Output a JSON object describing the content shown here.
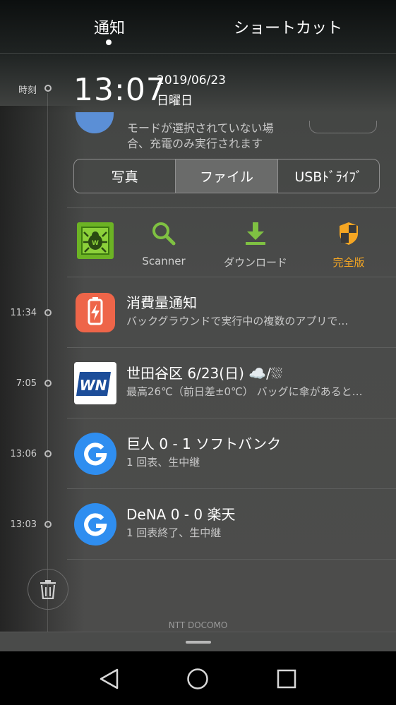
{
  "tabs": {
    "notify": "通知",
    "shortcut": "ショートカット"
  },
  "header": {
    "time_label": "時刻",
    "time": "13:07",
    "date": "2019/06/23",
    "weekday": "日曜日"
  },
  "usb": {
    "text_line1": "モードが選択されていない場",
    "text_line2": "合、充電のみ実行されます",
    "segments": [
      "写真",
      "ファイル",
      "USBﾄﾞﾗｲﾌﾞ"
    ]
  },
  "drweb": {
    "scanner": "Scanner",
    "download": "ダウンロード",
    "full": "完全版",
    "accent": "#f5a623"
  },
  "notifications": [
    {
      "time": "11:34",
      "title": "消費量通知",
      "body": "バックグラウンドで実行中の複数のアプリで…",
      "icon": "battery-alert-icon",
      "color": "#ee6549"
    },
    {
      "time": "7:05",
      "title": "世田谷区 6/23(日) ☁️/⛆",
      "body": "最高26℃（前日差±0℃） バッグに傘があると…",
      "icon": "weathernews-icon"
    },
    {
      "time": "13:06",
      "title": "巨人 0 - 1 ソフトバンク",
      "body": "1 回表、生中継",
      "icon": "google-icon",
      "color": "#2f8ef0"
    },
    {
      "time": "13:03",
      "title": "DeNA 0 - 0 楽天",
      "body": "1 回表終了、生中継",
      "icon": "google-icon",
      "color": "#2f8ef0"
    }
  ],
  "carrier": "NTT DOCOMO"
}
